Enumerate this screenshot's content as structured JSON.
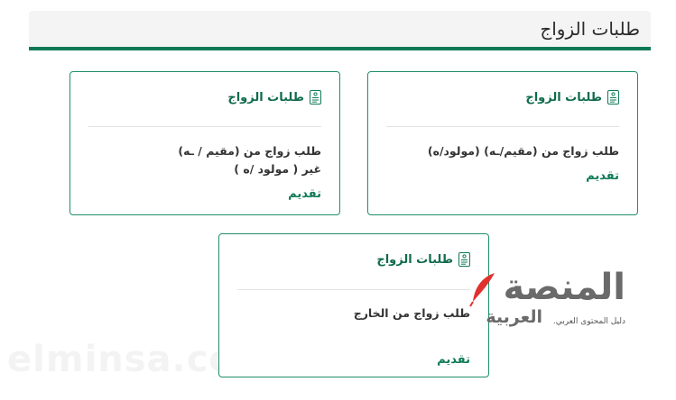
{
  "header": {
    "title": "طلبات الزواج"
  },
  "cards": [
    {
      "title": "طلبات الزواج",
      "description": "طلب زواج من (مقيم/ـه) (مولود/ه)",
      "action": "تقديم"
    },
    {
      "title": "طلبات الزواج",
      "description": "طلب زواج من (مقيم / ـه) غير ( مولود /ه )",
      "action": "تقديم"
    },
    {
      "title": "طلبات الزواج",
      "description": "طلب زواج من الخارج",
      "action": "تقديم"
    }
  ],
  "watermark": {
    "site": "elminsa.com",
    "logo_main": "المنصة",
    "logo_sub": "العربية",
    "logo_tagline": "دليل المحتوى العربي."
  },
  "colors": {
    "accent": "#0f7a55",
    "border": "#1f8f66",
    "logo_red": "#e0312f"
  },
  "icons": {
    "card_icon": "document-icon",
    "logo_icon": "feather-icon"
  }
}
